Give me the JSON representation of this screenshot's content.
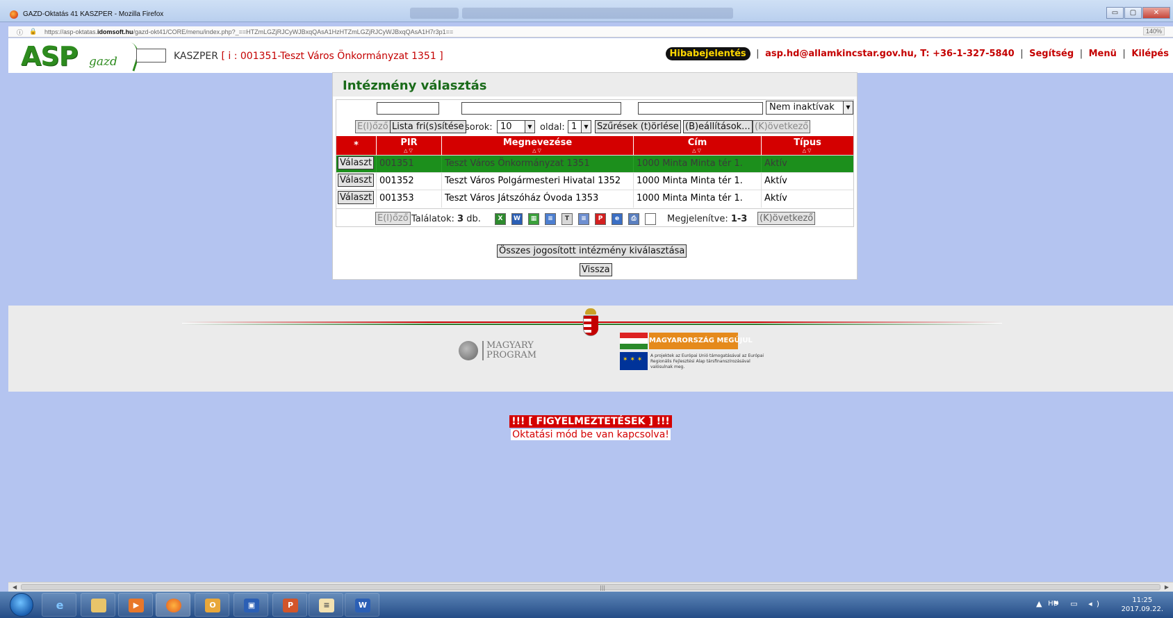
{
  "window": {
    "title": "GAZD-Oktatás 41 KASZPER - Mozilla Firefox",
    "controls": [
      "▭",
      "▢",
      "✕"
    ]
  },
  "browser": {
    "url_prefix": "https://asp-oktatas.",
    "url_domain": "idomsoft.hu",
    "url_rest": "/gazd-okt41/CORE/menu/index.php?_==HTZmLGZjRJCyWJBxqQAsA1HzHTZmLGZjRJCyWJBxqQAsA1H7r3p1==",
    "zoom": "140%"
  },
  "header": {
    "logo_text": "ASP",
    "logo_sub": "gazd",
    "app_name": "KASZPER",
    "org": "[ i : 001351-Teszt Város Önkormányzat 1351 ]",
    "bug_report": "Hibabejelentés",
    "contact": "asp.hd@allamkincstar.gov.hu, T: +36-1-327-5840",
    "help": "Segítség",
    "menu": "Menü",
    "logout": "Kilépés",
    "separator": "|"
  },
  "panel": {
    "title": "Intézmény választás",
    "filter": {
      "status_selected": "Nem inaktívak"
    },
    "toolbar": {
      "prev": "E(l)őző",
      "refresh": "Lista fri(s)sítése",
      "rows_label": "sorok:",
      "rows_value": "10",
      "page_label": "oldal:",
      "page_value": "1",
      "clear_filters": "Szűrések (t)örlése",
      "settings": "(B)eállítások...",
      "next": "(K)övetkező"
    },
    "table": {
      "columns": [
        "*",
        "PIR",
        "Megnevezése",
        "Cím",
        "Típus"
      ],
      "select_label": "Választ",
      "rows": [
        {
          "pir": "001351",
          "name": "Teszt Város Önkormányzat 1351",
          "address": "1000 Minta Minta tér 1.",
          "type": "Aktív"
        },
        {
          "pir": "001352",
          "name": "Teszt Város Polgármesteri Hivatal 1352",
          "address": "1000 Minta Minta tér 1.",
          "type": "Aktív"
        },
        {
          "pir": "001353",
          "name": "Teszt Város Játszóház Óvoda 1353",
          "address": "1000 Minta Minta tér 1.",
          "type": "Aktív"
        }
      ]
    },
    "pager": {
      "prev": "E(l)őző",
      "results_label": "Találatok:",
      "results_count": "3",
      "results_unit": "db.",
      "shown_label": "Megjelenítve:",
      "shown_range": "1-3",
      "next": "(K)övetkező"
    },
    "select_all": "Összes jogosított intézmény kiválasztása",
    "back": "Vissza"
  },
  "footer": {
    "magyary_line1": "MAGYARY",
    "magyary_line2": "PROGRAM",
    "eu_banner": "MAGYARORSZÁG MEGÚJUL",
    "eu_text": "A projektek az Európai Unió támogatásával az Európai Regionális Fejlesztési Alap társfinanszírozásával valósulnak meg."
  },
  "warnings": {
    "title": "!!! [ FIGYELMEZTETÉSEK ] !!!",
    "message": "Oktatási mód be van kapcsolva!"
  },
  "taskbar": {
    "lang": "HU",
    "time": "11:25",
    "date": "2017.09.22."
  },
  "colors": {
    "page_bg": "#b4c4f0",
    "accent_red": "#d40000",
    "selected_row": "#1c8f1c",
    "title_green": "#1a6b1a"
  }
}
